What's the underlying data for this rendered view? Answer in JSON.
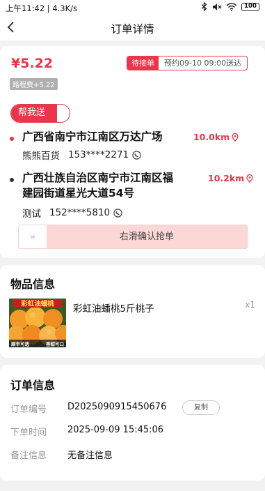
{
  "status_bar": {
    "time": "上午11:42 | 4.3K/s",
    "battery": "100",
    "icons": [
      "bluetooth-icon",
      "mute-icon",
      "wifi-icon",
      "battery-icon"
    ]
  },
  "nav": {
    "title": "订单详情",
    "back_icon": "chevron-left-icon"
  },
  "order": {
    "price": "¥5.22",
    "fee_tag": "路程费+5.22",
    "status": "待接单",
    "appointment": "预约09-10 09:00送达",
    "service_type": "帮我送",
    "pickup": {
      "address": "广西省南宁市江南区万达广场",
      "distance": "10.0km",
      "name": "熊熊百货",
      "phone": "153****2271"
    },
    "dropoff": {
      "address_line1": "广西壮族自治区南宁市江南区福",
      "address_line2": "建园街道星光大道54号",
      "distance": "10.2km",
      "name": "测试",
      "phone": "152****5810"
    },
    "slider": {
      "handle": "»",
      "label": "右滑确认抢单"
    }
  },
  "goods": {
    "title": "物品信息",
    "items": [
      {
        "name": "彩虹油蟠桃5斤桃子",
        "qty": "x1",
        "image_text_top": "彩虹油蟠桃",
        "image_text_left": "顺丰可选",
        "image_text_right": "香甜可口"
      }
    ]
  },
  "order_info": {
    "title": "订单信息",
    "rows": [
      {
        "label": "订单编号",
        "value": "D2025090915450676",
        "action": "复制"
      },
      {
        "label": "下单时间",
        "value": "2025-09-09 15:45:06"
      },
      {
        "label": "备注信息",
        "value": "无备注信息"
      }
    ]
  },
  "colors": {
    "accent": "#e8364a",
    "slider_track": "#fbd7d5",
    "background": "#f2f2f2"
  }
}
